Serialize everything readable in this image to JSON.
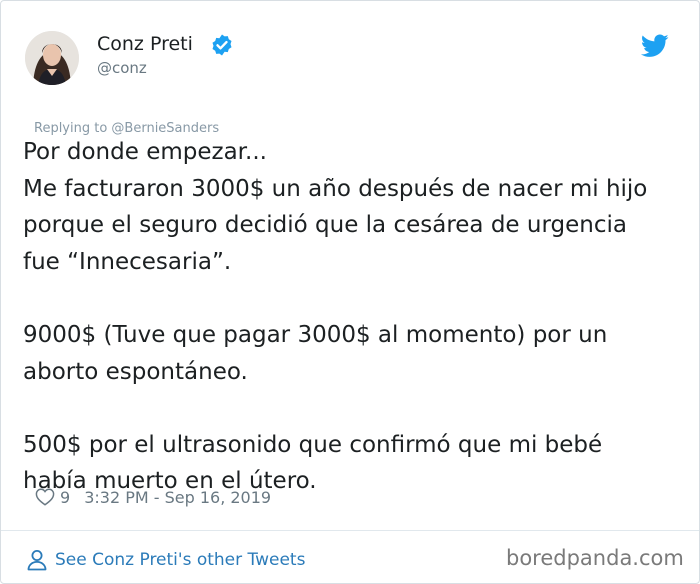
{
  "author": {
    "name": "Conz Preti",
    "handle": "@conz",
    "verified": true
  },
  "reply_context": "Replying to @BernieSanders",
  "tweet": {
    "paragraphs": [
      [
        "Por donde empezar...",
        "Me facturaron 3000$ un año después de nacer mi hijo",
        "porque el seguro decidió que la cesárea de urgencia",
        "fue “Innecesaria”."
      ],
      [
        "9000$ (Tuve que pagar 3000$ al momento) por un",
        "aborto espontáneo."
      ],
      [
        "500$ por el ultrasonido que confirmó que mi bebé",
        "había muerto en el útero."
      ]
    ]
  },
  "meta": {
    "likes": "9",
    "timestamp": "3:32 PM - Sep 16, 2019"
  },
  "footer": {
    "see_more_label": "See Conz Preti's other Tweets"
  },
  "watermark": "boredpanda.com",
  "colors": {
    "twitter_blue": "#1da1f2",
    "link_blue": "#2b7bb9",
    "text": "#1c2022",
    "muted": "#697882"
  },
  "icons": [
    "verified-badge-icon",
    "twitter-bird-icon",
    "heart-icon",
    "person-icon"
  ]
}
